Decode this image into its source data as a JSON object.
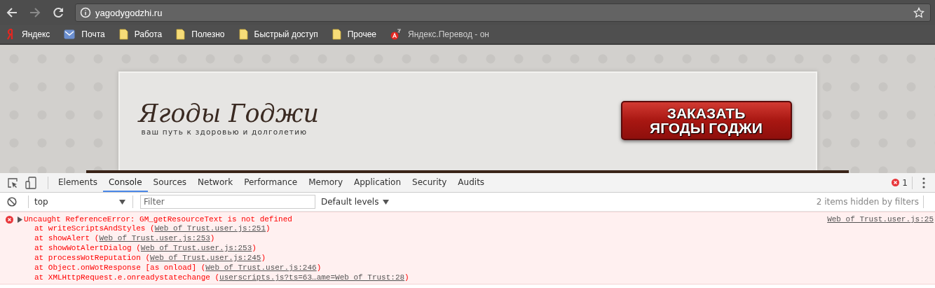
{
  "browser": {
    "url": "yagodygodzhi.ru",
    "bookmarks": [
      {
        "kind": "yandex",
        "label": "Яндекс"
      },
      {
        "kind": "mail",
        "label": "Почта"
      },
      {
        "kind": "folder",
        "label": "Работа"
      },
      {
        "kind": "folder",
        "label": "Полезно"
      },
      {
        "kind": "folder",
        "label": "Быстрый доступ"
      },
      {
        "kind": "folder",
        "label": "Прочее"
      },
      {
        "kind": "translate",
        "label": "Яндекс.Перевод - он"
      }
    ]
  },
  "page": {
    "logo": "Ягоды Годжи",
    "tagline": "ваш путь к здоровью и долголетию",
    "order_button": "ЗАКАЗАТЬ ЯГОДЫ ГОДЖИ"
  },
  "devtools": {
    "tabs": [
      {
        "label": "Elements",
        "selected": false
      },
      {
        "label": "Console",
        "selected": true
      },
      {
        "label": "Sources",
        "selected": false
      },
      {
        "label": "Network",
        "selected": false
      },
      {
        "label": "Performance",
        "selected": false
      },
      {
        "label": "Memory",
        "selected": false
      },
      {
        "label": "Application",
        "selected": false
      },
      {
        "label": "Security",
        "selected": false
      },
      {
        "label": "Audits",
        "selected": false
      }
    ],
    "error_count": "1",
    "context": "top",
    "filter_placeholder": "Filter",
    "levels": "Default levels",
    "hidden_note": "2 items hidden by filters",
    "messages": [
      {
        "kind": "error",
        "text": "Uncaught ReferenceError: GM_getResourceText is not defined",
        "source": "Web of Trust.user.js:25",
        "stack": [
          {
            "before": "at writeScriptsAndStyles (",
            "link": "Web of Trust.user.js:251",
            "after": ")"
          },
          {
            "before": "at showAlert (",
            "link": "Web of Trust.user.js:253",
            "after": ")"
          },
          {
            "before": "at showWotAlertDialog (",
            "link": "Web of Trust.user.js:253",
            "after": ")"
          },
          {
            "before": "at processWotReputation (",
            "link": "Web of Trust.user.js:245",
            "after": ")"
          },
          {
            "before": "at Object.onWotResponse [as onload] (",
            "link": "Web of Trust.user.js:246",
            "after": ")"
          },
          {
            "before": "at XMLHttpRequest.e.onreadystatechange (",
            "link": "userscripts.js?ts=63…ame=Web of Trust:28",
            "after": ")"
          }
        ]
      }
    ]
  }
}
